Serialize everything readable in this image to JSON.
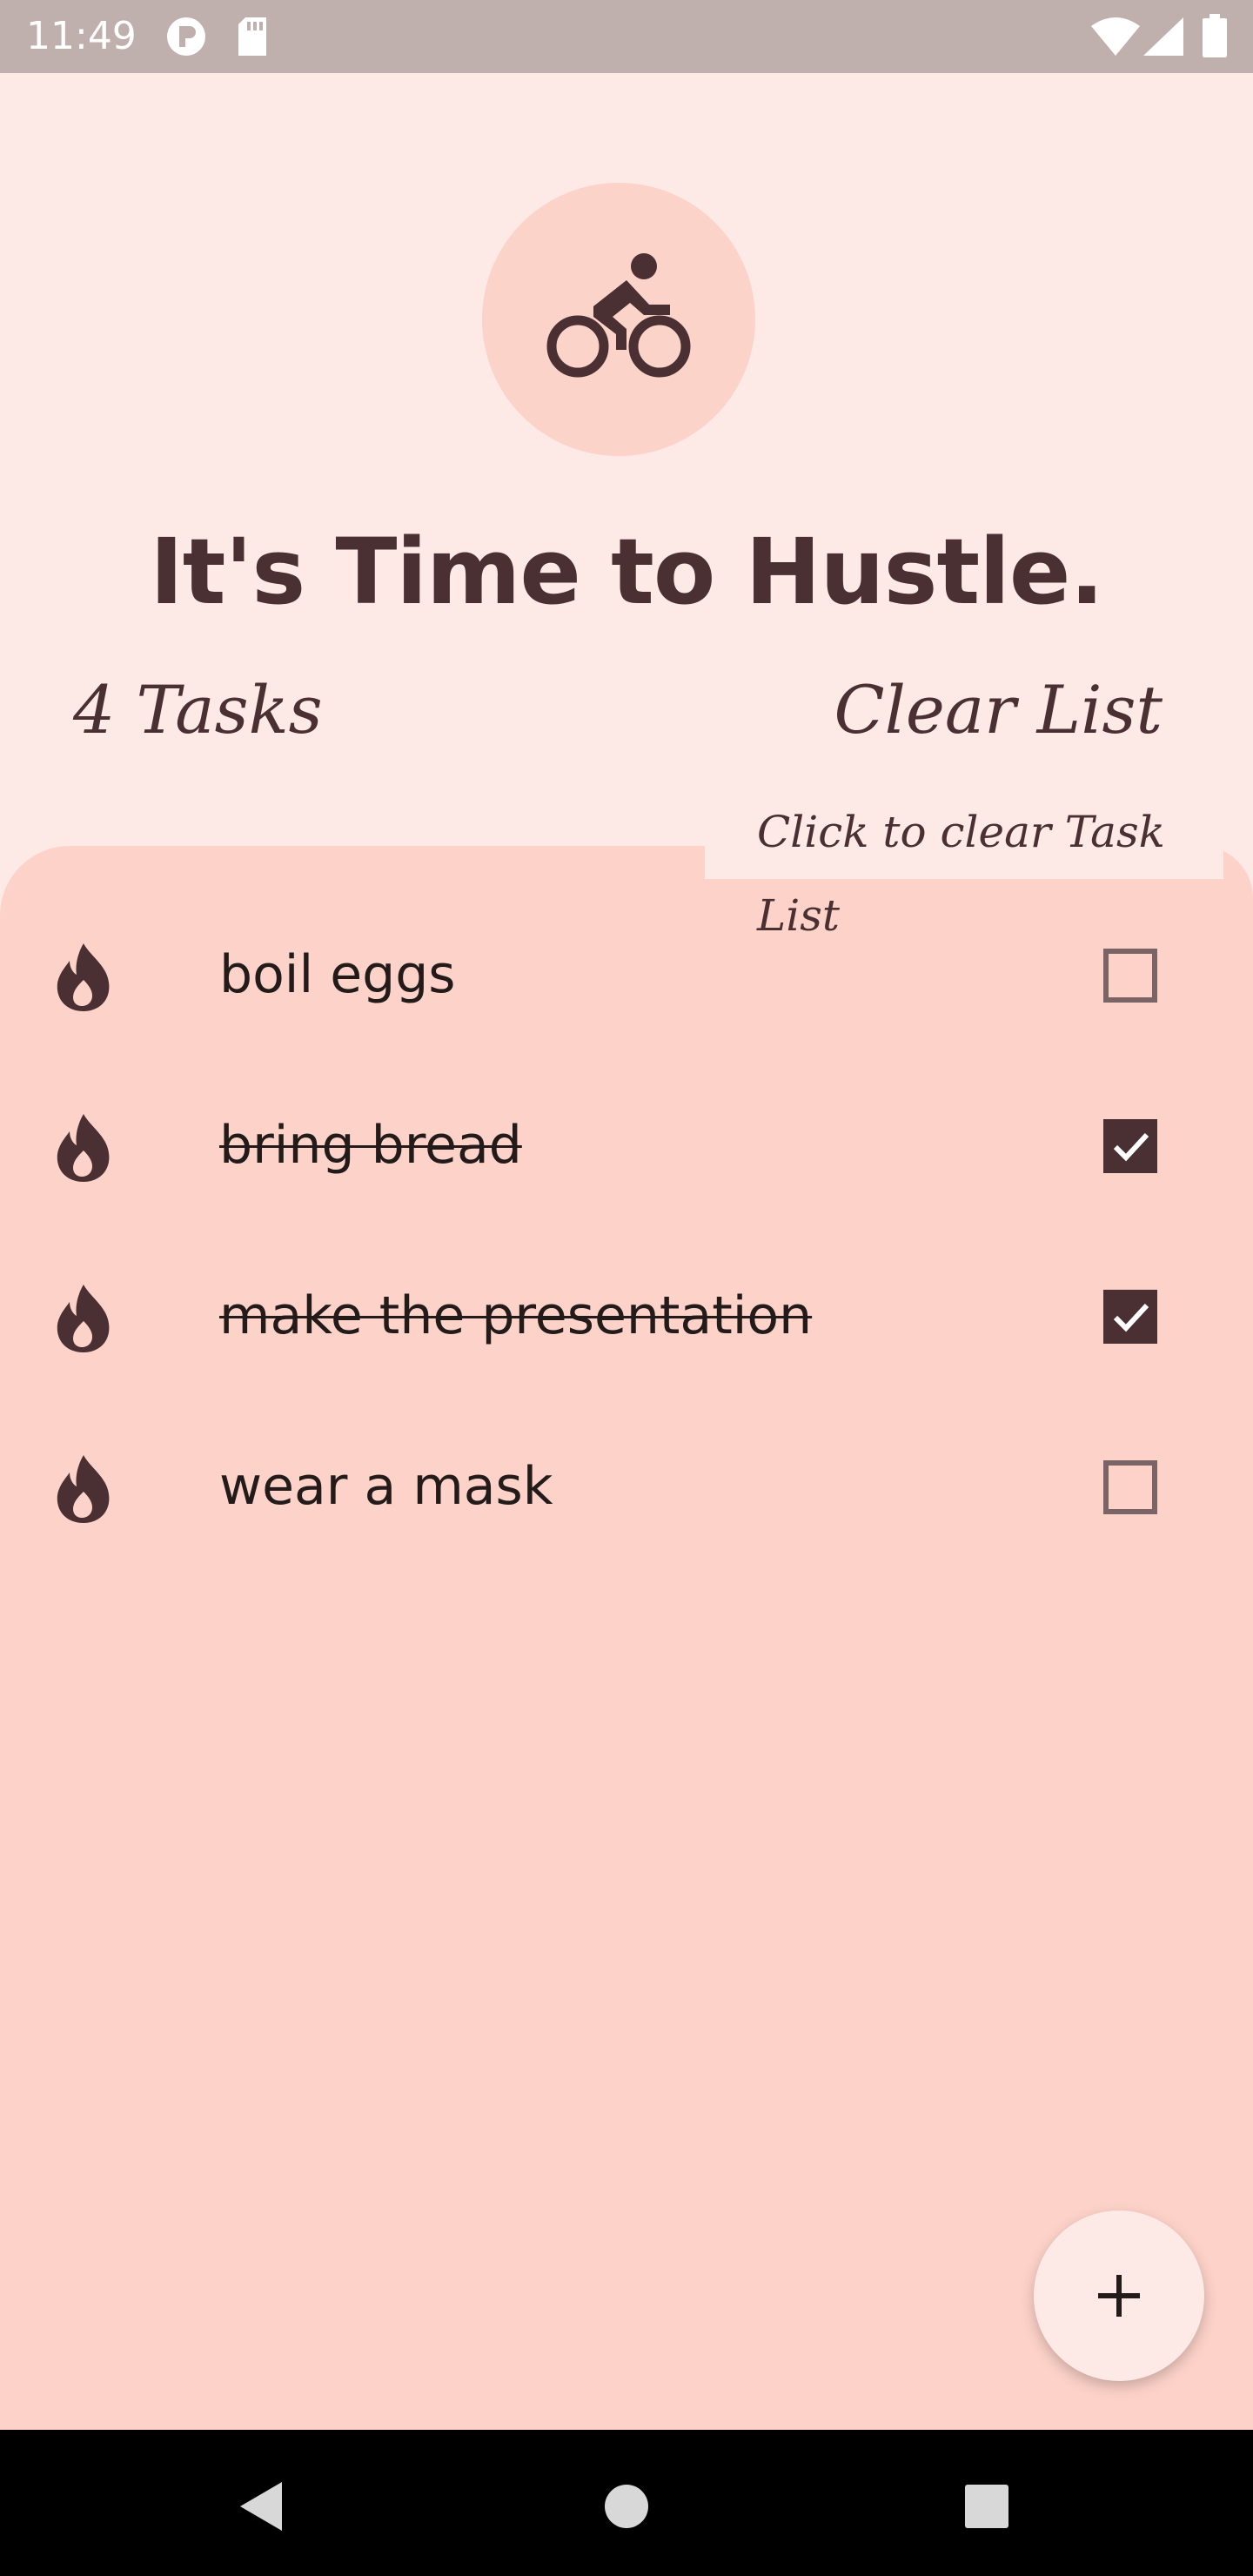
{
  "status_bar": {
    "time": "11:49",
    "icons": [
      "app-notification-icon",
      "sd-card-icon",
      "wifi-icon",
      "cellular-signal-icon",
      "battery-icon"
    ]
  },
  "header": {
    "avatar_icon": "bicycle-icon",
    "title": "It's Time to Hustle.",
    "task_count": "4 Tasks",
    "clear_list": "Clear List",
    "tooltip": "Click to clear Task List"
  },
  "tasks": [
    {
      "text": "boil eggs",
      "done": false,
      "icon": "flame-icon"
    },
    {
      "text": "bring bread",
      "done": true,
      "icon": "flame-icon"
    },
    {
      "text": "make the presentation",
      "done": true,
      "icon": "flame-icon"
    },
    {
      "text": "wear a mask",
      "done": false,
      "icon": "flame-icon"
    }
  ],
  "fab": {
    "icon": "plus-icon"
  },
  "nav": {
    "icons": [
      "back-icon",
      "home-icon",
      "recents-icon"
    ]
  },
  "colors": {
    "background": "#fde9e5",
    "sheet": "#fdd3c9",
    "accent": "#4a2f33",
    "status_bar": "#bfb0ae"
  }
}
